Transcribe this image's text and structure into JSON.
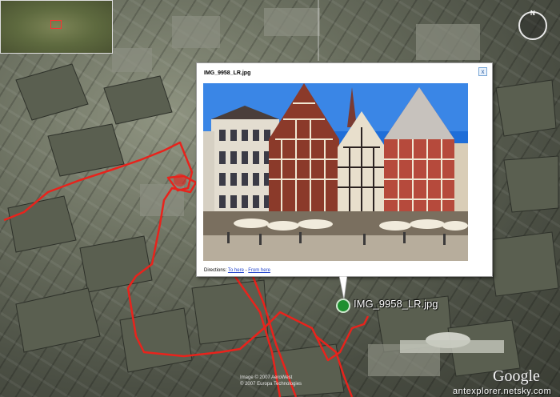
{
  "balloon": {
    "title": "IMG_9958_LR.jpg",
    "close": "x",
    "directions_label": "Directions:",
    "to_here": "To here",
    "separator": " - ",
    "from_here": "From here"
  },
  "placemark": {
    "label": "IMG_9958_LR.jpg"
  },
  "map": {
    "top_label": "",
    "compass_n": "N",
    "copyright_line1": "Image © 2007 AeroWest",
    "copyright_line2": "© 2007 Europa Technologies",
    "brand": "Google",
    "watermark": "antexplorer.netsky.com"
  },
  "colors": {
    "track": "#e8231c",
    "pin": "#1e8f2f",
    "link": "#2244cc"
  }
}
